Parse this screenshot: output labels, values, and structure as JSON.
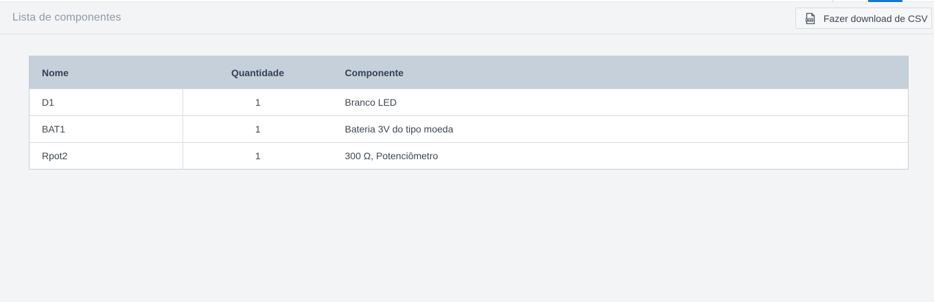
{
  "header": {
    "title": "Lista de componentes",
    "download_label": "Fazer download de CSV",
    "download_icon": "csv-file-icon"
  },
  "table": {
    "columns": [
      "Nome",
      "Quantidade",
      "Componente"
    ],
    "rows": [
      {
        "name": "D1",
        "quantity": "1",
        "component": "Branco LED"
      },
      {
        "name": "BAT1",
        "quantity": "1",
        "component": "Bateria 3V do tipo moeda"
      },
      {
        "name": "Rpot2",
        "quantity": "1",
        "component": "300 Ω, Potenciômetro"
      }
    ]
  },
  "colors": {
    "background": "#f3f4f6",
    "table_header": "#c5d0db",
    "accent": "#1477d1",
    "title_text": "#8f9aa5"
  }
}
